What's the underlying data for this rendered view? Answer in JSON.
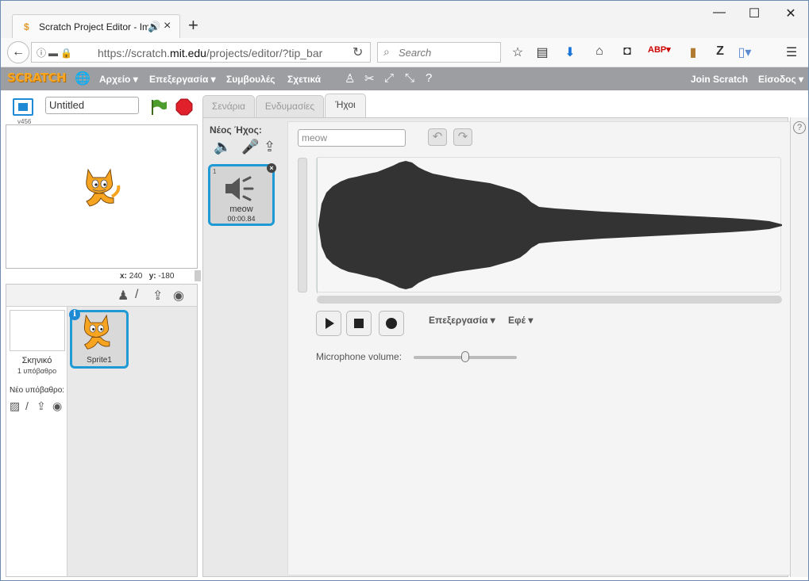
{
  "browser": {
    "tab_title": "Scratch Project Editor - Imagine, Program, Share",
    "new_tab": "+",
    "url_protocol": "https://scratch.",
    "url_domain": "mit.edu",
    "url_path": "/projects/editor/?tip_bar",
    "search_placeholder": "Search",
    "window_controls": [
      "minimize",
      "maximize",
      "close"
    ]
  },
  "scratch_menu": {
    "logo": "SCRATCH",
    "items": [
      "Αρχείο ▾",
      "Επεξεργασία ▾",
      "Συμβουλές",
      "Σχετικά"
    ],
    "right": [
      "Join Scratch",
      "Είσοδος ▾"
    ]
  },
  "stage": {
    "version": "v456",
    "project_title": "Untitled",
    "x_label": "x:",
    "x_value": "240",
    "y_label": "y:",
    "y_value": "-180"
  },
  "sprites": {
    "stage_label": "Σκηνικό",
    "stage_sub": "1 υπόβαθρο",
    "new_backdrop": "Νέο υπόβαθρο:",
    "sprite_name": "Sprite1",
    "info": "i"
  },
  "editor": {
    "tabs": [
      "Σενάρια",
      "Ενδυμασίες",
      "Ήχοι"
    ],
    "active_tab": "Ήχοι",
    "new_sound_label": "Νέος Ήχος:",
    "sound": {
      "number": "1",
      "name": "meow",
      "duration": "00:00.84"
    },
    "sound_name_field": "meow",
    "edit_menu": "Επεξεργασία ▾",
    "effects_menu": "Εφέ ▾",
    "mic_label": "Microphone volume:",
    "mic_volume": 0.5
  },
  "colors": {
    "menubar": "#9c9ea2",
    "accent": "#1f9ad4",
    "waveform": "#333333",
    "flag": "#4c9c2e",
    "stop": "#e0202a"
  }
}
